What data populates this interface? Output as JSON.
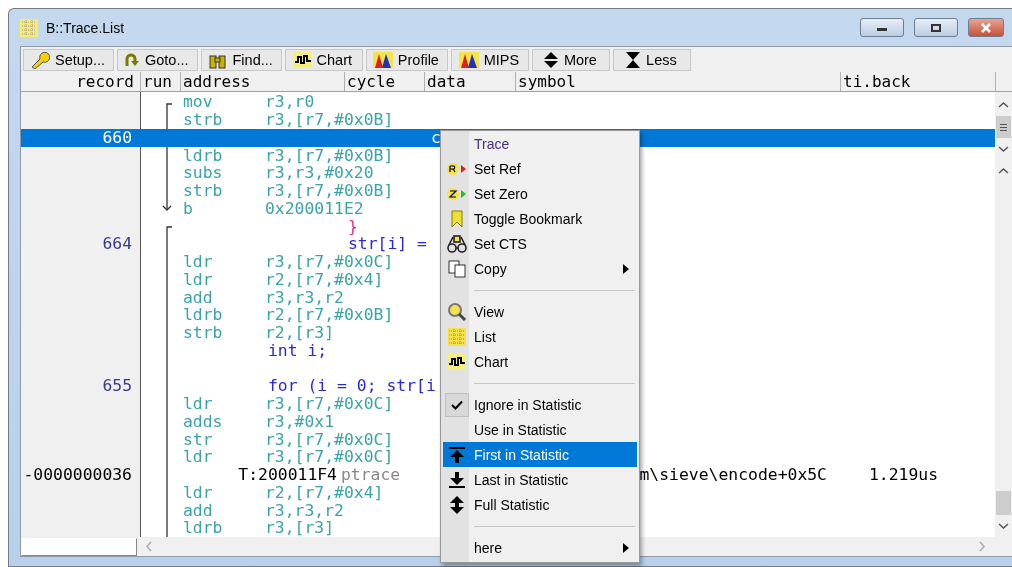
{
  "window": {
    "title": "B::Trace.List"
  },
  "toolbar": [
    {
      "label": "Setup..."
    },
    {
      "label": "Goto..."
    },
    {
      "label": "Find..."
    },
    {
      "label": "Chart"
    },
    {
      "label": "Profile"
    },
    {
      "label": "MIPS"
    },
    {
      "label": "More"
    },
    {
      "label": "Less"
    }
  ],
  "columns": [
    "record",
    "run",
    "address",
    "cycle",
    "data",
    "symbol",
    "ti.back"
  ],
  "lines": [
    {
      "kind": "asm",
      "mnemonic": "mov",
      "operands": "r3,r0",
      "selected": false
    },
    {
      "kind": "asm",
      "mnemonic": "strb",
      "operands": "r3,[r7,#0x0B]",
      "selected": false
    },
    {
      "kind": "record",
      "record": "660",
      "data": "c",
      "selected": true
    },
    {
      "kind": "asm",
      "mnemonic": "ldrb",
      "operands": "r3,[r7,#0x0B]",
      "selected": false
    },
    {
      "kind": "asm",
      "mnemonic": "subs",
      "operands": "r3,r3,#0x20",
      "selected": false
    },
    {
      "kind": "asm",
      "mnemonic": "strb",
      "operands": "r3,[r7,#0x0B]",
      "selected": false
    },
    {
      "kind": "asm",
      "mnemonic": "b",
      "operands": "0x200011E2",
      "selected": false
    },
    {
      "kind": "brace",
      "text": "}",
      "nested": true,
      "selected": false
    },
    {
      "kind": "source",
      "record": "664",
      "text": "str[i] =",
      "nested": true,
      "selected": false
    },
    {
      "kind": "asm",
      "mnemonic": "ldr",
      "operands": "r3,[r7,#0x0C]",
      "selected": false
    },
    {
      "kind": "asm",
      "mnemonic": "ldr",
      "operands": "r2,[r7,#0x4]",
      "selected": false
    },
    {
      "kind": "asm",
      "mnemonic": "add",
      "operands": "r3,r3,r2",
      "selected": false
    },
    {
      "kind": "asm",
      "mnemonic": "ldrb",
      "operands": "r2,[r7,#0x0B]",
      "selected": false
    },
    {
      "kind": "asm",
      "mnemonic": "strb",
      "operands": "r2,[r3]",
      "selected": false
    },
    {
      "kind": "source",
      "text": "int i;",
      "nested": false,
      "selected": false
    },
    {
      "kind": "blank",
      "selected": false
    },
    {
      "kind": "source",
      "record": "655",
      "text": "for (i = 0; str[i",
      "nested": false,
      "selected": false
    },
    {
      "kind": "asm",
      "mnemonic": "ldr",
      "operands": "r3,[r7,#0x0C]",
      "selected": false
    },
    {
      "kind": "asm",
      "mnemonic": "adds",
      "operands": "r3,#0x1",
      "selected": false
    },
    {
      "kind": "asm",
      "mnemonic": "str",
      "operands": "r3,[r7,#0x0C]",
      "selected": false
    },
    {
      "kind": "asm",
      "mnemonic": "ldr",
      "operands": "r3,[r7,#0x0C]",
      "selected": false
    },
    {
      "kind": "trace",
      "record": "-0000000036",
      "address": "T:200011F4",
      "cycle": "ptrace",
      "symbol": "m\\sieve\\encode+0x5C",
      "ti_back": "1.219us",
      "selected": false
    },
    {
      "kind": "asm",
      "mnemonic": "ldr",
      "operands": "r2,[r7,#0x4]",
      "selected": false
    },
    {
      "kind": "asm",
      "mnemonic": "add",
      "operands": "r3,r3,r2",
      "selected": false
    },
    {
      "kind": "asm",
      "mnemonic": "ldrb",
      "operands": "r3,[r3]",
      "selected": false
    }
  ],
  "context_menu": [
    {
      "kind": "header",
      "label": "Trace"
    },
    {
      "kind": "item",
      "label": "Set Ref",
      "checked": false,
      "selected": false,
      "submenu": false
    },
    {
      "kind": "item",
      "label": "Set Zero",
      "checked": false,
      "selected": false,
      "submenu": false
    },
    {
      "kind": "item",
      "label": "Toggle Bookmark",
      "checked": false,
      "selected": false,
      "submenu": false
    },
    {
      "kind": "item",
      "label": "Set CTS",
      "checked": false,
      "selected": false,
      "submenu": false
    },
    {
      "kind": "item",
      "label": "Copy",
      "checked": false,
      "selected": false,
      "submenu": true
    },
    {
      "kind": "separator"
    },
    {
      "kind": "item",
      "label": "View",
      "checked": false,
      "selected": false,
      "submenu": false
    },
    {
      "kind": "item",
      "label": "List",
      "checked": false,
      "selected": false,
      "submenu": false
    },
    {
      "kind": "item",
      "label": "Chart",
      "checked": false,
      "selected": false,
      "submenu": false
    },
    {
      "kind": "separator"
    },
    {
      "kind": "item",
      "label": "Ignore in Statistic",
      "checked": true,
      "selected": false,
      "submenu": false
    },
    {
      "kind": "item",
      "label": "Use in Statistic",
      "checked": false,
      "selected": false,
      "submenu": false
    },
    {
      "kind": "item",
      "label": "First in Statistic",
      "checked": false,
      "selected": true,
      "submenu": false
    },
    {
      "kind": "item",
      "label": "Last in Statistic",
      "checked": false,
      "selected": false,
      "submenu": false
    },
    {
      "kind": "item",
      "label": "Full Statistic",
      "checked": false,
      "selected": false,
      "submenu": false
    },
    {
      "kind": "separator"
    },
    {
      "kind": "item",
      "label": "here",
      "checked": false,
      "selected": false,
      "submenu": true
    }
  ]
}
